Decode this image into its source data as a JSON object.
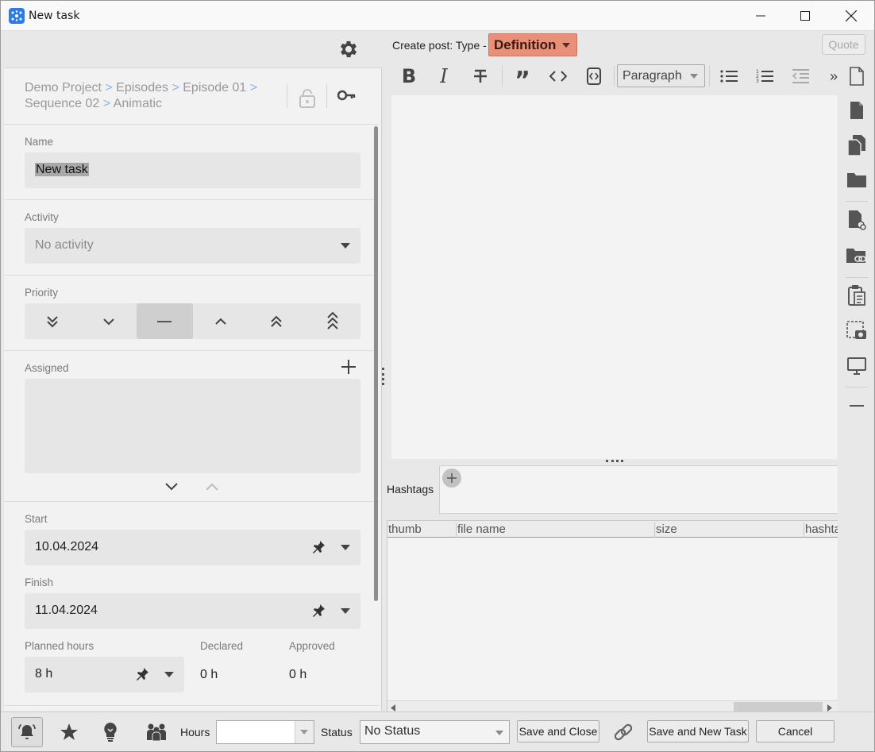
{
  "window": {
    "title": "New task"
  },
  "breadcrumb": {
    "items": [
      "Demo Project",
      "Episodes",
      "Episode 01",
      "Sequence 02",
      "Animatic"
    ],
    "separator": ">"
  },
  "form": {
    "name_label": "Name",
    "name_value": "New task",
    "activity_label": "Activity",
    "activity_value": "No activity",
    "priority_label": "Priority",
    "priority_levels": [
      "lowest",
      "low",
      "normal",
      "high",
      "highest",
      "critical"
    ],
    "priority_selected": "normal",
    "assigned_label": "Assigned",
    "start_label": "Start",
    "start_value": "10.04.2024",
    "finish_label": "Finish",
    "finish_value": "11.04.2024",
    "planned_hours_label": "Planned hours",
    "planned_hours_value": "8 h",
    "declared_label": "Declared",
    "declared_value": "0 h",
    "approved_label": "Approved",
    "approved_value": "0 h"
  },
  "post": {
    "create_label": "Create post: Type -",
    "type_value": "Definition",
    "type_color": "#e8907a",
    "quote_label": "Quote",
    "paragraph_value": "Paragraph",
    "hashtags_label": "Hashtags",
    "columns": [
      "thumb",
      "file name",
      "size",
      "hashtags"
    ]
  },
  "toolbar": {
    "icons": [
      "bold-icon",
      "italic-icon",
      "strikethrough-icon",
      "quote-icon",
      "code-icon",
      "code-block-icon",
      "bullet-list-icon",
      "numbered-list-icon",
      "outdent-icon",
      "more-icon"
    ]
  },
  "sidebar": {
    "icons": [
      "new-page-icon",
      "file-icon",
      "copy-files-icon",
      "folder-icon",
      "file-link-icon",
      "folder-link-icon",
      "clipboard-icon",
      "screenshot-icon",
      "monitor-icon",
      "minus-icon"
    ]
  },
  "bottom": {
    "hours_label": "Hours",
    "hours_value": "",
    "status_label": "Status",
    "status_value": "No Status",
    "save_close_label": "Save and Close",
    "save_new_label": "Save and New Task",
    "cancel_label": "Cancel"
  }
}
